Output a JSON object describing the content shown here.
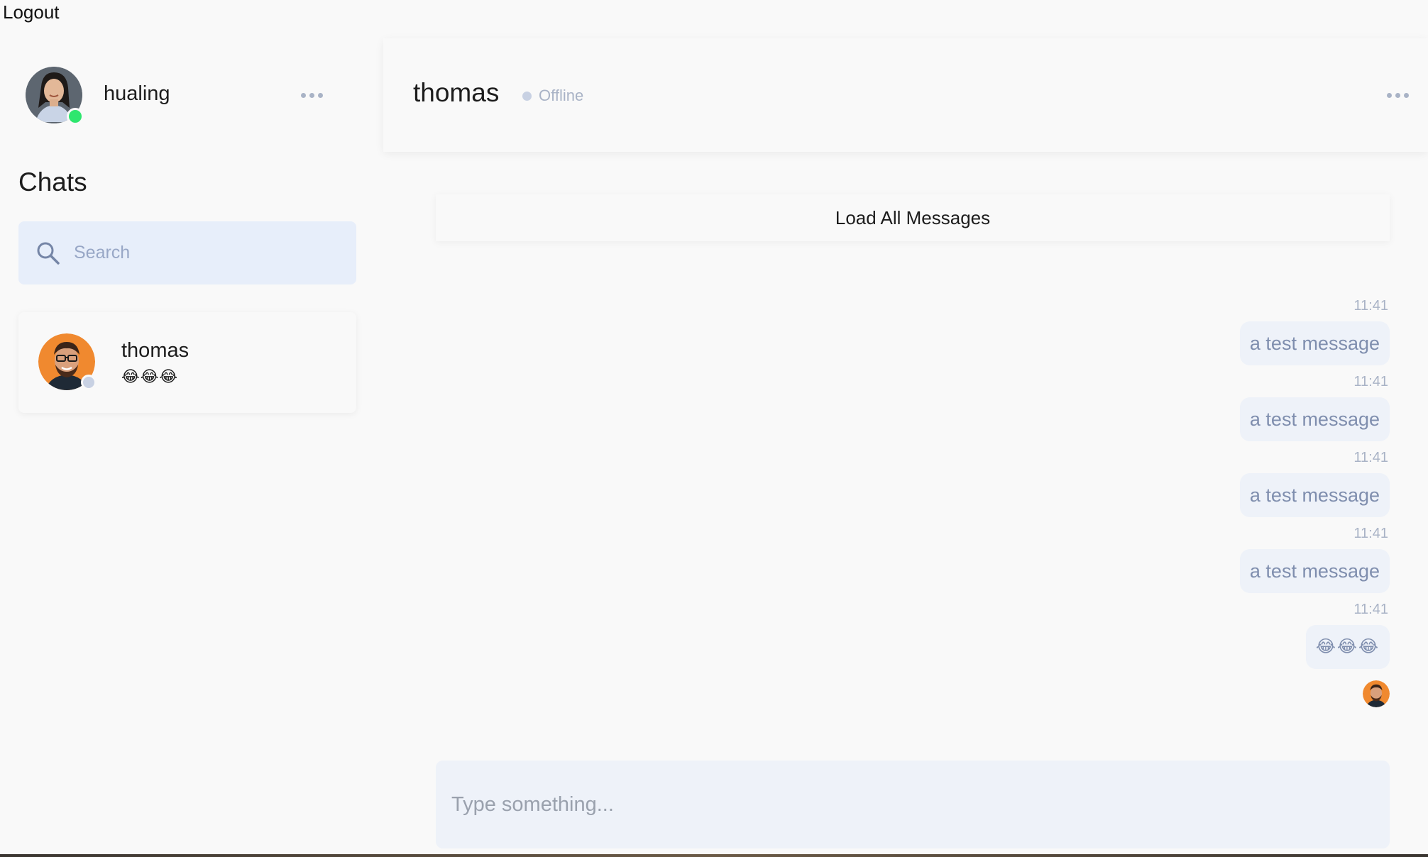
{
  "topbar": {
    "logout_label": "Logout"
  },
  "current_user": {
    "name": "hualing",
    "status_color": "#2ee66e"
  },
  "sidebar": {
    "title": "Chats",
    "search": {
      "placeholder": "Search",
      "value": ""
    },
    "chats": [
      {
        "name": "thomas",
        "preview": "😂😂😂",
        "status_color": "#c8d1e3"
      }
    ]
  },
  "conversation": {
    "contact_name": "thomas",
    "contact_status": "Offline",
    "load_all_label": "Load All Messages",
    "messages": [
      {
        "time": "11:41",
        "text": "a test message"
      },
      {
        "time": "11:41",
        "text": "a test message"
      },
      {
        "time": "11:41",
        "text": "a test message"
      },
      {
        "time": "11:41",
        "text": "a test message"
      },
      {
        "time": "11:41",
        "text": "😂😂😂"
      }
    ],
    "composer": {
      "placeholder": "Type something...",
      "value": ""
    }
  },
  "icons": {
    "search": "search-icon",
    "more": "more-dots-icon"
  },
  "colors": {
    "background": "#f9f9f9",
    "search_bg": "#e7eefa",
    "bubble_bg": "#eef2f9",
    "bubble_text": "#7f8eae",
    "muted": "#a9b3c6",
    "online": "#2ee66e",
    "offline": "#c8d1e3"
  }
}
